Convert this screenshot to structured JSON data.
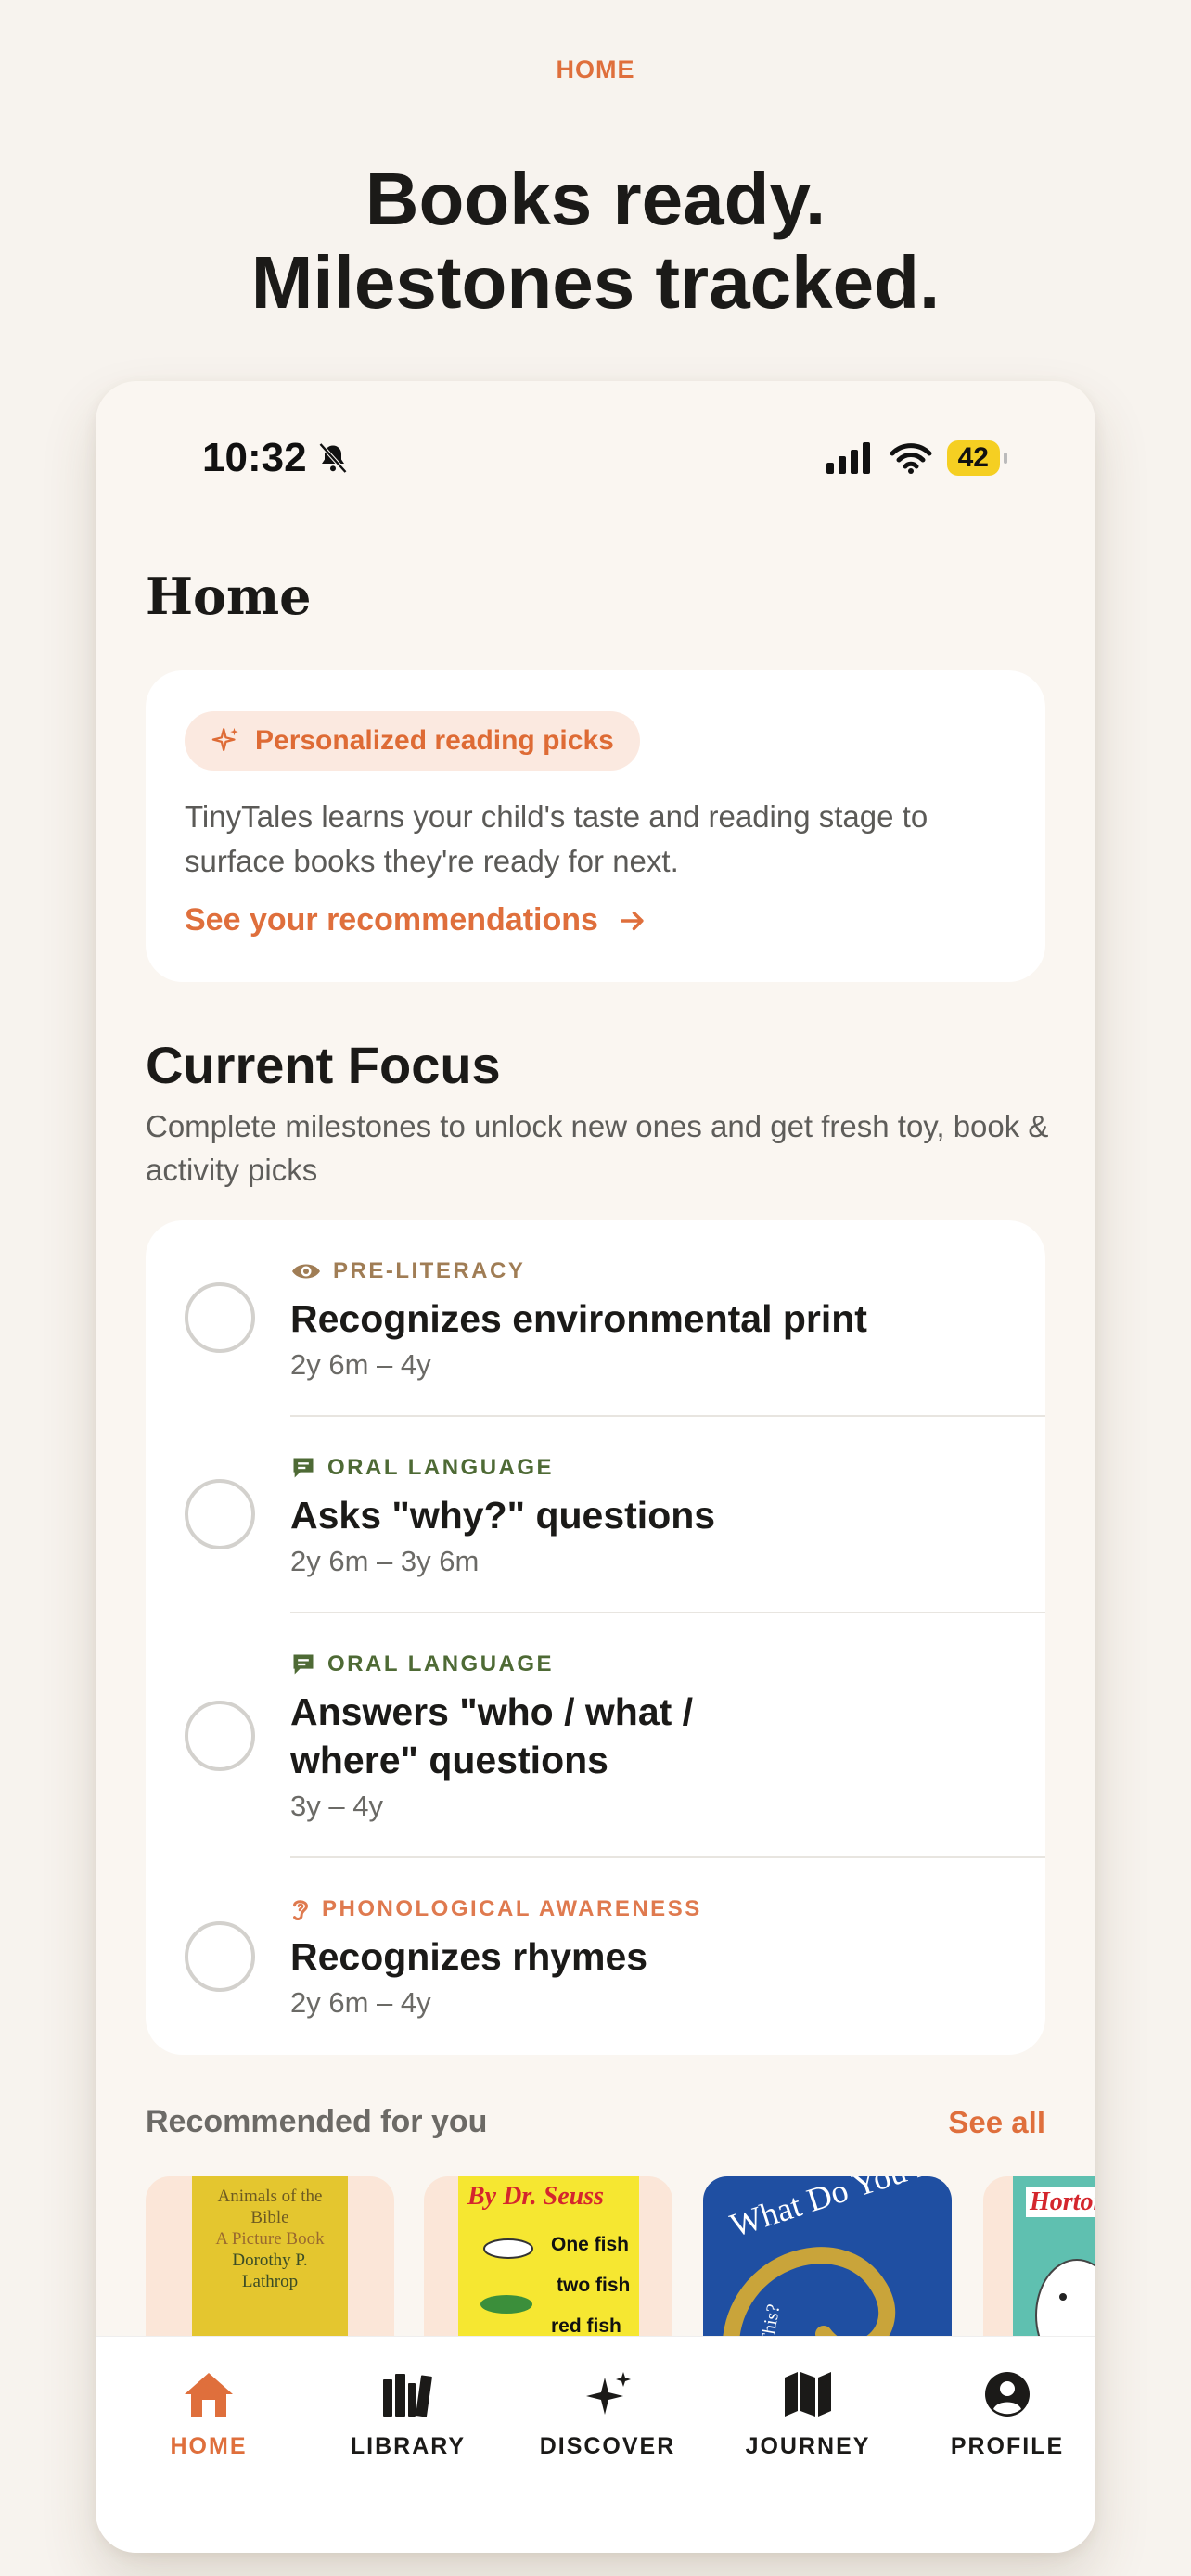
{
  "screen_label": "HOME",
  "headline": {
    "line1": "Books ready.",
    "line2": "Milestones tracked."
  },
  "status_bar": {
    "time": "10:32",
    "battery": "42"
  },
  "page_title": "Home",
  "promo": {
    "pill": "Personalized reading picks",
    "description": "TinyTales learns your child's taste and reading stage to surface books they're ready for next.",
    "link": "See your recommendations"
  },
  "focus": {
    "title": "Current Focus",
    "subtitle": "Complete milestones to unlock new ones and get fresh toy, book & activity picks",
    "milestones": [
      {
        "category": "PRE-LITERACY",
        "icon": "eye-icon",
        "color": "#a07d55",
        "title": "Recognizes environmental print",
        "range": "2y 6m – 4y"
      },
      {
        "category": "ORAL LANGUAGE",
        "icon": "speech-bubble-icon",
        "color": "#4e6a35",
        "title": "Asks \"why?\" questions",
        "range": "2y 6m – 3y 6m"
      },
      {
        "category": "ORAL LANGUAGE",
        "icon": "speech-bubble-icon",
        "color": "#4e6a35",
        "title": "Answers \"who / what / where\" questions",
        "range": "3y – 4y"
      },
      {
        "category": "PHONOLOGICAL AWARENESS",
        "icon": "ear-icon",
        "color": "#df7a4f",
        "title": "Recognizes rhymes",
        "range": "2y 6m – 4y"
      }
    ]
  },
  "recommended": {
    "title": "Recommended for you",
    "see_all": "See all",
    "books": [
      {
        "cover_lines": [
          "Animals of the",
          "Bible",
          "A Picture Book",
          "Dorothy P.",
          "Lathrop"
        ]
      },
      {
        "cover_lines": [
          "By Dr. Seuss",
          "One fish",
          "two fish",
          "red fish"
        ]
      },
      {
        "cover_lines": [
          "What Do You Do W",
          "This?"
        ]
      },
      {
        "cover_lines": [
          "Horton"
        ]
      }
    ]
  },
  "tabs": [
    {
      "label": "HOME",
      "icon": "house-icon",
      "active": true
    },
    {
      "label": "LIBRARY",
      "icon": "books-icon",
      "active": false
    },
    {
      "label": "DISCOVER",
      "icon": "sparkle-icon",
      "active": false
    },
    {
      "label": "JOURNEY",
      "icon": "map-icon",
      "active": false
    },
    {
      "label": "PROFILE",
      "icon": "user-circle-icon",
      "active": false
    }
  ],
  "colors": {
    "accent": "#df6f3c",
    "background": "#f7f3ee",
    "card": "#ffffff"
  }
}
